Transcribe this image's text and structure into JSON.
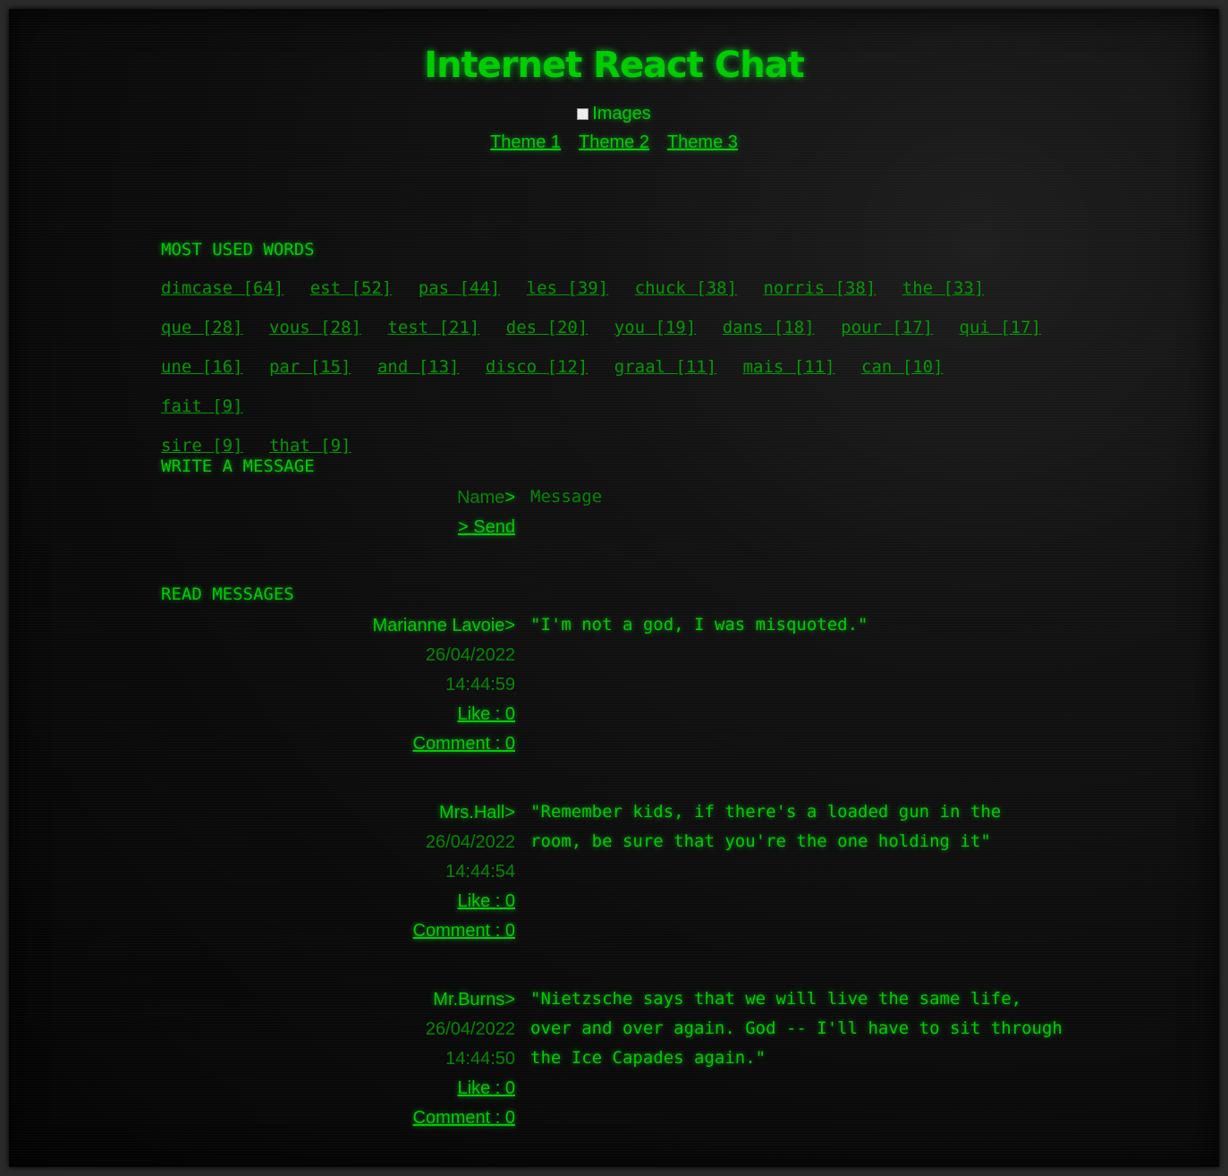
{
  "header": {
    "title": "Internet React Chat",
    "images_label": "Images",
    "themes": [
      "Theme 1",
      "Theme 2",
      "Theme 3"
    ]
  },
  "most_used": {
    "title": "MOST USED WORDS",
    "words": [
      "dimcase [64]",
      "est [52]",
      "pas [44]",
      "les [39]",
      "chuck [38]",
      "norris [38]",
      "the [33]",
      "que [28]",
      "vous [28]",
      "test [21]",
      "des [20]",
      "you [19]",
      "dans [18]",
      "pour [17]",
      "qui [17]",
      "une [16]",
      "par [15]",
      "and [13]",
      "disco [12]",
      "graal [11]",
      "mais [11]",
      "can [10]",
      "fait [9]",
      "sire [9]",
      "that [9]"
    ]
  },
  "write": {
    "title": "WRITE A MESSAGE",
    "name_placeholder": "Name",
    "prompt": ">",
    "message_placeholder": "Message",
    "send_label": "> Send"
  },
  "read": {
    "title": "READ MESSAGES",
    "messages": [
      {
        "author": "Marianne Lavoie>",
        "date": "26/04/2022",
        "time": "14:44:59",
        "like": "Like : 0",
        "comment": "Comment : 0",
        "text": "\"I'm not a god, I was misquoted.\""
      },
      {
        "author": "Mrs.Hall>",
        "date": "26/04/2022",
        "time": "14:44:54",
        "like": "Like : 0",
        "comment": "Comment : 0",
        "text": "\"Remember kids, if there's a loaded gun in the room, be sure that you're the one holding it\""
      },
      {
        "author": "Mr.Burns>",
        "date": "26/04/2022",
        "time": "14:44:50",
        "like": "Like : 0",
        "comment": "Comment : 0",
        "text": "\"Nietzsche says that we will live the same life, over and over again. God -- I'll have to sit through the Ice Capades again.\""
      }
    ]
  },
  "colors": {
    "text": "#00cc00",
    "dim": "#009900",
    "background": "#0a0a0a"
  }
}
